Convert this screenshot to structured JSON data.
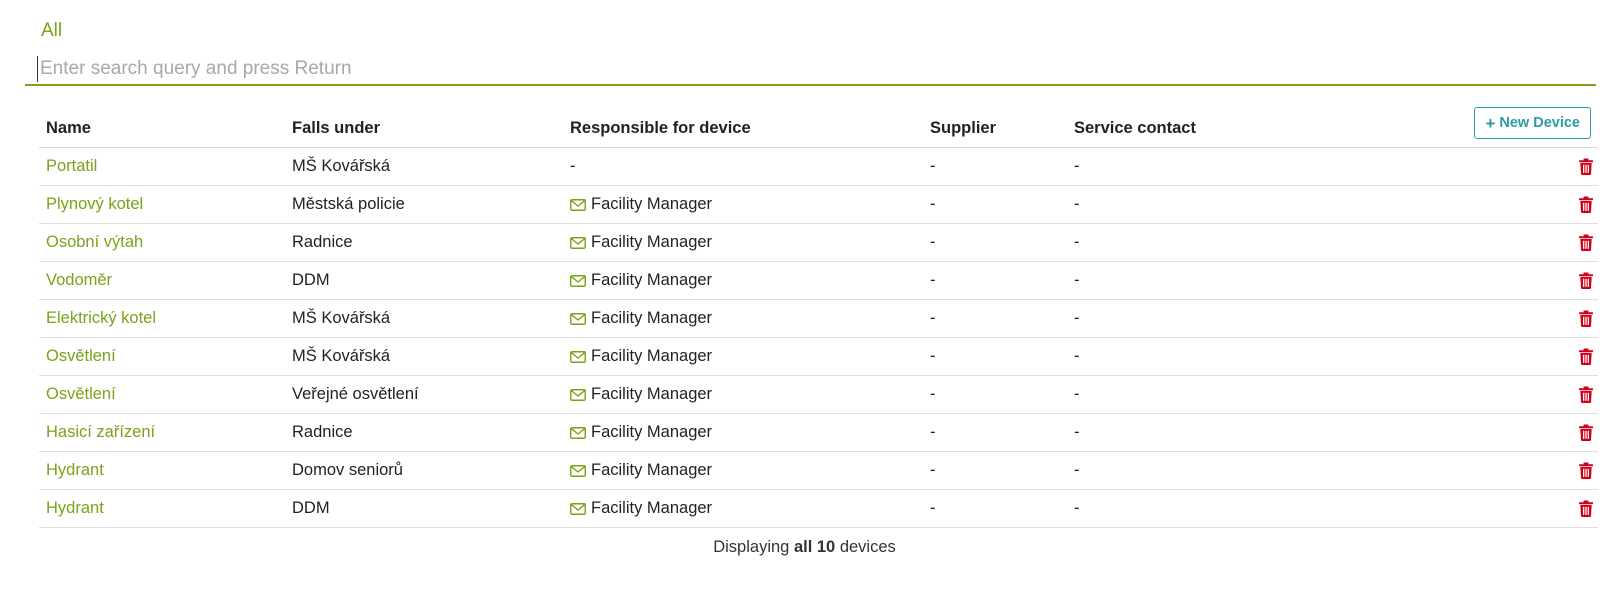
{
  "filter": {
    "active_tab": "All"
  },
  "search": {
    "placeholder": "Enter search query and press Return",
    "value": ""
  },
  "table": {
    "headers": {
      "name": "Name",
      "falls_under": "Falls under",
      "responsible": "Responsible for device",
      "supplier": "Supplier",
      "service_contact": "Service contact"
    },
    "new_device_label": "New Device",
    "rows": [
      {
        "name": "Portatil",
        "falls_under": "MŠ Kovářská",
        "responsible": "-",
        "responsible_has_email": false,
        "supplier": "-",
        "service_contact": "-"
      },
      {
        "name": "Plynový kotel",
        "falls_under": "Městská policie",
        "responsible": "Facility Manager",
        "responsible_has_email": true,
        "supplier": "-",
        "service_contact": "-"
      },
      {
        "name": "Osobní výtah",
        "falls_under": "Radnice",
        "responsible": "Facility Manager",
        "responsible_has_email": true,
        "supplier": "-",
        "service_contact": "-"
      },
      {
        "name": "Vodoměr",
        "falls_under": "DDM",
        "responsible": "Facility Manager",
        "responsible_has_email": true,
        "supplier": "-",
        "service_contact": "-"
      },
      {
        "name": "Elektrický kotel",
        "falls_under": "MŠ Kovářská",
        "responsible": "Facility Manager",
        "responsible_has_email": true,
        "supplier": "-",
        "service_contact": "-"
      },
      {
        "name": "Osvětlení",
        "falls_under": "MŠ Kovářská",
        "responsible": "Facility Manager",
        "responsible_has_email": true,
        "supplier": "-",
        "service_contact": "-"
      },
      {
        "name": "Osvětlení",
        "falls_under": "Veřejné osvětlení",
        "responsible": "Facility Manager",
        "responsible_has_email": true,
        "supplier": "-",
        "service_contact": "-"
      },
      {
        "name": "Hasicí zařízení",
        "falls_under": "Radnice",
        "responsible": "Facility Manager",
        "responsible_has_email": true,
        "supplier": "-",
        "service_contact": "-"
      },
      {
        "name": "Hydrant",
        "falls_under": "Domov seniorů",
        "responsible": "Facility Manager",
        "responsible_has_email": true,
        "supplier": "-",
        "service_contact": "-"
      },
      {
        "name": "Hydrant",
        "falls_under": "DDM",
        "responsible": "Facility Manager",
        "responsible_has_email": true,
        "supplier": "-",
        "service_contact": "-"
      }
    ]
  },
  "footer": {
    "prefix": "Displaying",
    "total": "all 10",
    "suffix": "devices"
  },
  "colors": {
    "accent_green": "#7aa21a",
    "button_teal": "#2b9ca4",
    "delete_red": "#d0021b"
  },
  "icons": {
    "new_device": "plus-icon",
    "responsible": "envelope-icon",
    "delete": "trash-icon"
  }
}
